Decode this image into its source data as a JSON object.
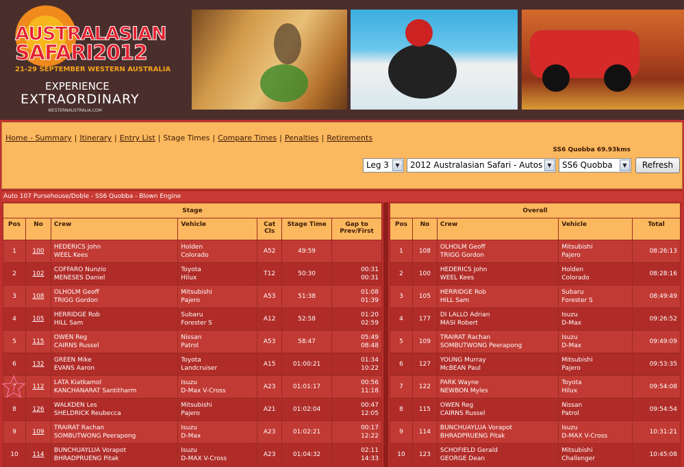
{
  "banner": {
    "logo_line1": "AUSTRALASIAN",
    "logo_line2": "SAFARI2012",
    "logo_dates": "21-29 SEPTEMBER WESTERN AUSTRALIA",
    "logo_tag1": "EXPERIENCE",
    "logo_tag2": "EXTRAORDINARY",
    "logo_url": "WESTERNAUSTRALIA.COM"
  },
  "nav": {
    "items": [
      "Home - Summary",
      "Itinerary",
      "Entry List",
      "Stage Times",
      "Compare Times",
      "Penalties",
      "Retirements"
    ],
    "separator": "|"
  },
  "stage_name": "SS6 Quobba 69.93kms",
  "selects": {
    "leg": "Leg 3",
    "event": "2012 Australasian Safari - Autos",
    "stage": "SS6 Quobba"
  },
  "refresh_label": "Refresh",
  "info_line": "Auto 107 Pursehouse/Doble - SS6 Quobba - Blown Engine",
  "stage_table": {
    "group_title": "Stage",
    "headers": [
      "Pos",
      "No",
      "Crew",
      "Vehicle",
      "Cat Cls",
      "Stage Time",
      "Gap to Prev/First"
    ],
    "rows": [
      {
        "pos": "1",
        "no": "100",
        "crew1": "HEDERICS John",
        "crew2": "WEEL Kees",
        "veh1": "Holden",
        "veh2": "Colorado",
        "cat": "A52",
        "time": "49:59",
        "gap1": "",
        "gap2": ""
      },
      {
        "pos": "2",
        "no": "102",
        "crew1": "COFFARO Nunzio",
        "crew2": "MENESES Daniel",
        "veh1": "Toyota",
        "veh2": "Hilux",
        "cat": "T12",
        "time": "50:30",
        "gap1": "00:31",
        "gap2": "00:31"
      },
      {
        "pos": "3",
        "no": "108",
        "crew1": "OLHOLM Geoff",
        "crew2": "TRIGG Gordon",
        "veh1": "Mitsubishi",
        "veh2": "Pajero",
        "cat": "A53",
        "time": "51:38",
        "gap1": "01:08",
        "gap2": "01:39"
      },
      {
        "pos": "4",
        "no": "105",
        "crew1": "HERRIDGE Rob",
        "crew2": "HILL Sam",
        "veh1": "Subaru",
        "veh2": "Forester S",
        "cat": "A12",
        "time": "52:58",
        "gap1": "01:20",
        "gap2": "02:59"
      },
      {
        "pos": "5",
        "no": "115",
        "crew1": "OWEN Reg",
        "crew2": "CAIRNS Russel",
        "veh1": "Nissan",
        "veh2": "Patrol",
        "cat": "A53",
        "time": "58:47",
        "gap1": "05:49",
        "gap2": "08:48"
      },
      {
        "pos": "6",
        "no": "132",
        "crew1": "GREEN Mike",
        "crew2": "EVANS Aaron",
        "veh1": "Toyota",
        "veh2": "Landcruiser",
        "cat": "A15",
        "time": "01:00:21",
        "gap1": "01:34",
        "gap2": "10:22"
      },
      {
        "pos": "7",
        "no": "112",
        "crew1": "LATA Kiatkamol",
        "crew2": "KANCHANARAT Santitharm",
        "veh1": "Isuzu",
        "veh2": "D-Max V-Cross",
        "cat": "A23",
        "time": "01:01:17",
        "gap1": "00:56",
        "gap2": "11:18"
      },
      {
        "pos": "8",
        "no": "126",
        "crew1": "WALKDEN Les",
        "crew2": "SHELDRICK Reubecca",
        "veh1": "Mitsubishi",
        "veh2": "Pajero",
        "cat": "A21",
        "time": "01:02:04",
        "gap1": "00:47",
        "gap2": "12:05"
      },
      {
        "pos": "9",
        "no": "109",
        "crew1": "TRAIRAT Rachan",
        "crew2": "SOMBUTWONG Peerapong",
        "veh1": "Isuzu",
        "veh2": "D-Max",
        "cat": "A23",
        "time": "01:02:21",
        "gap1": "00:17",
        "gap2": "12:22"
      },
      {
        "pos": "10",
        "no": "114",
        "crew1": "BUNCHUAYLUA Vorapot",
        "crew2": "BHRADPRUENG Pitak",
        "veh1": "Isuzu",
        "veh2": "D-MAX V-Cross",
        "cat": "A23",
        "time": "01:04:32",
        "gap1": "02:11",
        "gap2": "14:33"
      }
    ]
  },
  "overall_table": {
    "group_title": "Overall",
    "headers": [
      "Pos",
      "No",
      "Crew",
      "Vehicle",
      "Total"
    ],
    "rows": [
      {
        "pos": "1",
        "no": "108",
        "crew1": "OLHOLM  Geoff",
        "crew2": "TRIGG Gordon",
        "veh1": "Mitsubishi",
        "veh2": "Pajero",
        "total": "08:26:13"
      },
      {
        "pos": "2",
        "no": "100",
        "crew1": "HEDERICS John",
        "crew2": "WEEL Kees",
        "veh1": "Holden",
        "veh2": "Colorado",
        "total": "08:28:16"
      },
      {
        "pos": "3",
        "no": "105",
        "crew1": "HERRIDGE  Rob",
        "crew2": "HILL Sam",
        "veh1": "Subaru",
        "veh2": "Forester S",
        "total": "08:49:49"
      },
      {
        "pos": "4",
        "no": "177",
        "crew1": "DI LALLO Adrian",
        "crew2": "MASI Robert",
        "veh1": "Isuzu",
        "veh2": "D-Max",
        "total": "09:26:52"
      },
      {
        "pos": "5",
        "no": "109",
        "crew1": "TRAIRAT  Rachan",
        "crew2": "SOMBUTWONG Peerapong",
        "veh1": "Isuzu",
        "veh2": "D-Max",
        "total": "09:49:09"
      },
      {
        "pos": "6",
        "no": "127",
        "crew1": "YOUNG Murray",
        "crew2": "McBEAN Paul",
        "veh1": "Mitsubishi",
        "veh2": "Pajero",
        "total": "09:53:35"
      },
      {
        "pos": "7",
        "no": "122",
        "crew1": "PARK  Wayne",
        "crew2": "NEWBON Myles",
        "veh1": "Toyota",
        "veh2": "Hilux",
        "total": "09:54:08"
      },
      {
        "pos": "8",
        "no": "115",
        "crew1": "OWEN Reg",
        "crew2": "CAIRNS Russel",
        "veh1": "Nissan",
        "veh2": "Patrol",
        "total": "09:54:54"
      },
      {
        "pos": "9",
        "no": "114",
        "crew1": "BUNCHUAYLUA  Vorapot",
        "crew2": "BHRADPRUENG Pitak",
        "veh1": "Isuzu",
        "veh2": "D-MAX V-Cross",
        "total": "10:31:21"
      },
      {
        "pos": "10",
        "no": "123",
        "crew1": "SCHOFIELD Gerald",
        "crew2": "GEORGE Dean",
        "veh1": "Mitsubishi",
        "veh2": "Challenger",
        "total": "10:45:08"
      }
    ]
  },
  "highlight_star_label": "7"
}
